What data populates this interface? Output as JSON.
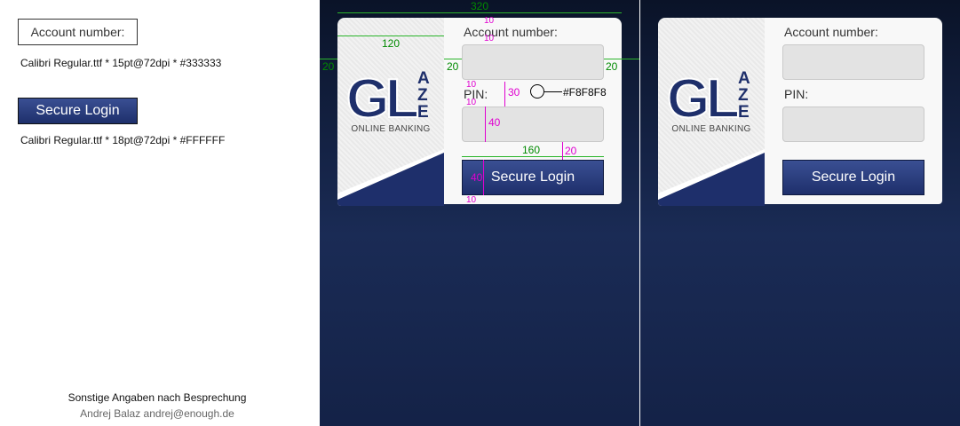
{
  "spec": {
    "label_sample": "Account number:",
    "label_font_note": "Calibri Regular.ttf * 15pt@72dpi * #333333",
    "button_sample": "Secure Login",
    "button_font_note": "Calibri Regular.ttf * 18pt@72dpi * #FFFFFF",
    "footer_line1": "Sonstige Angaben nach Besprechung",
    "footer_line2": "Andrej Balaz andrej@enough.de"
  },
  "login": {
    "account_label": "Account number:",
    "pin_label": "PIN:",
    "button_label": "Secure Login",
    "brand_caption": "ONLINE BANKING",
    "brand_letters": {
      "g": "G",
      "l": "L",
      "a": "A",
      "z": "Z",
      "e": "E"
    }
  },
  "annotations": {
    "width_total": "320",
    "width_logo": "120",
    "margin_left": "20",
    "margin_inner": "20",
    "margin_right": "20",
    "gap_top": "10",
    "gap_top2": "10",
    "gap_pin_top": "10",
    "gap_pin_bottom": "10",
    "pin_height": "30",
    "input_height": "40",
    "button_width": "160",
    "button_gap": "20",
    "button_height": "40",
    "gap_bottom": "10",
    "input_color": "#F8F8F8"
  },
  "colors": {
    "brand_blue": "#1e2f6b",
    "label_text": "#333333",
    "button_text": "#FFFFFF",
    "panel_bg": "#F8F8F8"
  }
}
